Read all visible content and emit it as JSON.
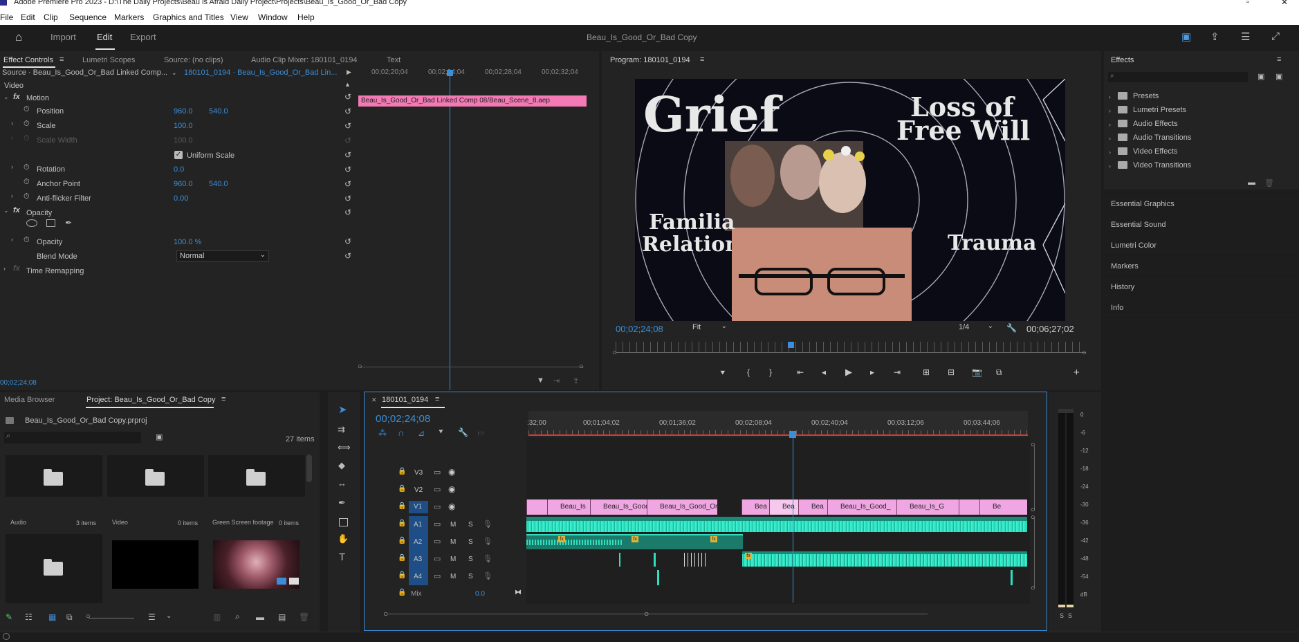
{
  "window": {
    "title": "Adobe Premiere Pro 2023 - D:\\The Daily Projects\\Beau is Afraid Daily Project\\Projects\\Beau_Is_Good_Or_Bad Copy"
  },
  "menu": [
    "File",
    "Edit",
    "Clip",
    "Sequence",
    "Markers",
    "Graphics and Titles",
    "View",
    "Window",
    "Help"
  ],
  "workspace": {
    "tabs": [
      "Import",
      "Edit",
      "Export"
    ],
    "active": "Edit",
    "project_title": "Beau_Is_Good_Or_Bad Copy"
  },
  "source_panel": {
    "tabs": [
      "Effect Controls",
      "Lumetri Scopes",
      "Source: (no clips)",
      "Audio Clip Mixer: 180101_0194",
      "Text"
    ],
    "source_label": "Source · Beau_Is_Good_Or_Bad Linked Comp...",
    "sequence_label": "180101_0194 · Beau_Is_Good_Or_Bad Lin...",
    "ruler_times": [
      "00;02;20;04",
      "00;02;24;04",
      "00;02;28;04",
      "00;02;32;04"
    ],
    "clip_name": "Beau_Is_Good_Or_Bad Linked Comp 08/Beau_Scene_8.aep",
    "section_video": "Video",
    "motion": "Motion",
    "position_label": "Position",
    "position_x": "960.0",
    "position_y": "540.0",
    "scale_label": "Scale",
    "scale_val": "100.0",
    "scale_width_label": "Scale Width",
    "scale_width_val": "100.0",
    "uniform_scale": "Uniform Scale",
    "rotation_label": "Rotation",
    "rotation_val": "0.0",
    "anchor_label": "Anchor Point",
    "anchor_x": "960.0",
    "anchor_y": "540.0",
    "antiflicker_label": "Anti-flicker Filter",
    "antiflicker_val": "0.00",
    "opacity_section": "Opacity",
    "opacity_label": "Opacity",
    "opacity_val": "100.0 %",
    "blend_label": "Blend Mode",
    "blend_val": "Normal",
    "time_remap": "Time Remapping",
    "timecode": "00;02;24;08"
  },
  "program": {
    "title": "Program: 180101_0194",
    "timecode": "00;02;24;08",
    "fit": "Fit",
    "quality": "1/4",
    "duration": "00;06;27;02",
    "frame_text": {
      "grief": "Grief",
      "loss1": "Loss of",
      "loss2": "Free Will",
      "fam1": "Familia",
      "fam2": "Relation",
      "trauma": "Trauma"
    }
  },
  "effects": {
    "title": "Effects",
    "items": [
      "Presets",
      "Lumetri Presets",
      "Audio Effects",
      "Audio Transitions",
      "Video Effects",
      "Video Transitions"
    ],
    "sections": [
      "Essential Graphics",
      "Essential Sound",
      "Lumetri Color",
      "Markers",
      "History",
      "Info"
    ]
  },
  "project": {
    "tabs": [
      "Media Browser",
      "Project: Beau_Is_Good_Or_Bad Copy"
    ],
    "file": "Beau_Is_Good_Or_Bad Copy.prproj",
    "count": "27 items",
    "bins": [
      {
        "name": "Audio",
        "count": "3 items"
      },
      {
        "name": "Video",
        "count": "0 items"
      },
      {
        "name": "Green Screen footage",
        "count": "0 items"
      }
    ]
  },
  "timeline": {
    "tab": "180101_0194",
    "timecode": "00;02;24;08",
    "ruler": [
      ":32;00",
      "00;01;04;02",
      "00;01;36;02",
      "00;02;08;04",
      "00;02;40;04",
      "00;03;12;06",
      "00;03;44;06"
    ],
    "video_tracks": [
      "V3",
      "V2",
      "V1"
    ],
    "audio_tracks": [
      "A1",
      "A2",
      "A3",
      "A4"
    ],
    "mix_label": "Mix",
    "mix_val": "0.0",
    "clips_v1": [
      "Beau_Is",
      "Beau_Is_Good",
      "Beau_Is_Good_Or",
      "Bea",
      "Bea",
      "Bea",
      "Beau_Is_Good_",
      "Beau_Is_G",
      "Be"
    ],
    "m": "M",
    "s": "S"
  },
  "meter": {
    "scale": [
      "0",
      "-6",
      "-12",
      "-18",
      "-24",
      "-30",
      "-36",
      "-42",
      "-48",
      "-54",
      "dB"
    ],
    "s_left": "S",
    "s_right": "S"
  }
}
